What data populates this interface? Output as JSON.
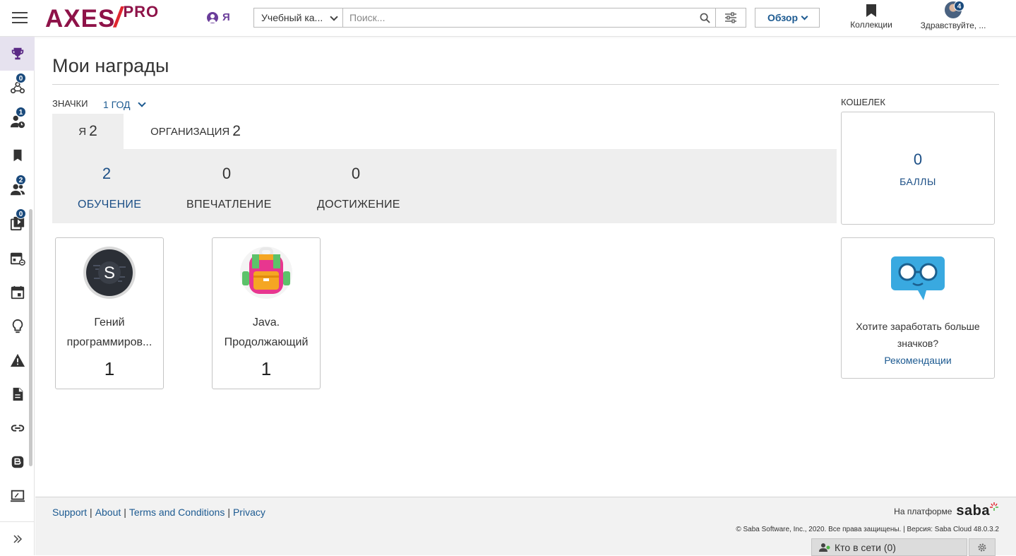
{
  "header": {
    "logo_main": "AXES",
    "logo_slash": "/",
    "logo_pro": "PRO",
    "me_label": "Я",
    "scope_value": "Учебный ка...",
    "search_placeholder": "Поиск...",
    "browse_label": "Обзор",
    "collections_label": "Коллекции",
    "greeting_label": "Здравствуйте, ...",
    "notifications_count": "4"
  },
  "sidebar": {
    "items": [
      {
        "icon": "trophy-icon",
        "badge": ""
      },
      {
        "icon": "team-icon",
        "badge": "0"
      },
      {
        "icon": "user-clock-icon",
        "badge": "1"
      },
      {
        "icon": "bookmark-icon",
        "badge": ""
      },
      {
        "icon": "people-icon",
        "badge": "2"
      },
      {
        "icon": "video-library-icon",
        "badge": "0"
      },
      {
        "icon": "calendar-list-icon",
        "badge": ""
      },
      {
        "icon": "calendar-icon",
        "badge": ""
      },
      {
        "icon": "lightbulb-icon",
        "badge": ""
      },
      {
        "icon": "warning-icon",
        "badge": ""
      },
      {
        "icon": "document-icon",
        "badge": ""
      },
      {
        "icon": "link-icon",
        "badge": ""
      },
      {
        "icon": "blog-icon",
        "badge": ""
      },
      {
        "icon": "screen-icon",
        "badge": ""
      }
    ]
  },
  "main": {
    "title": "Мои награды",
    "badges_label": "ЗНАЧКИ",
    "period": "1 ГОД",
    "tabs": [
      {
        "label": "Я",
        "count": "2"
      },
      {
        "label": "ОРГАНИЗАЦИЯ",
        "count": "2"
      }
    ],
    "stats": [
      {
        "value": "2",
        "label": "ОБУЧЕНИЕ"
      },
      {
        "value": "0",
        "label": "ВПЕЧАТЛЕНИЕ"
      },
      {
        "value": "0",
        "label": "ДОСТИЖЕНИЕ"
      }
    ],
    "badges": [
      {
        "name_line1": "Гений",
        "name_line2": "программиров...",
        "count": "1"
      },
      {
        "name_line1": "Java.",
        "name_line2": "Продолжающий",
        "count": "1"
      }
    ]
  },
  "wallet": {
    "label": "КОШЕЛЕК",
    "points": "0",
    "points_label": "БАЛЛЫ"
  },
  "promo": {
    "text": "Хотите заработать больше значков?",
    "link": "Рекомендации"
  },
  "footer": {
    "links": [
      "Support",
      "About",
      "Terms and Conditions",
      "Privacy"
    ],
    "powered_by": "На платформе",
    "brand": "saba",
    "copyright": "© Saba Software, Inc., 2020. Все права защищены. |   Версия: Saba Cloud 48.0.3.2",
    "online": "Кто в сети (0)"
  },
  "colors": {
    "brand_purple": "#8e1248",
    "brand_red": "#e0262f",
    "link_blue": "#1c5a91",
    "active_blue": "#1c4f86",
    "badge_navy": "#1a4a7c"
  }
}
